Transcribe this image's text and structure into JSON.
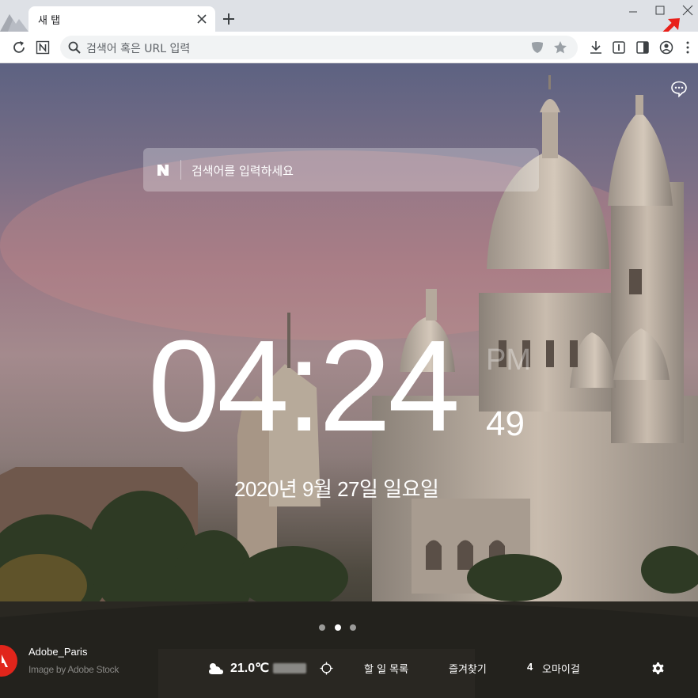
{
  "browser": {
    "tab_title": "새 탭",
    "address_placeholder": "검색어 혹은 URL 입력"
  },
  "page": {
    "search_placeholder": "검색어를 입력하세요",
    "clock": {
      "time": "04:24",
      "ampm": "PM",
      "seconds": "49",
      "date": "2020년 9월 27일 일요일"
    },
    "slides": {
      "count": 3,
      "active_index": 1
    },
    "credit": {
      "author": "Adobe_Paris",
      "source": "Image by Adobe Stock"
    },
    "weather": {
      "temperature": "21.0℃",
      "icon": "cloudy-icon"
    },
    "links": {
      "todo": "할 일 목록",
      "favorites": "즐겨찾기",
      "omai_count": "4",
      "omai": "오마이걸"
    }
  },
  "colors": {
    "tabstrip": "#dee1e6",
    "omnibox": "#f1f3f4",
    "annotation_arrow": "#e8201a",
    "adobe_red": "#e1251b"
  }
}
